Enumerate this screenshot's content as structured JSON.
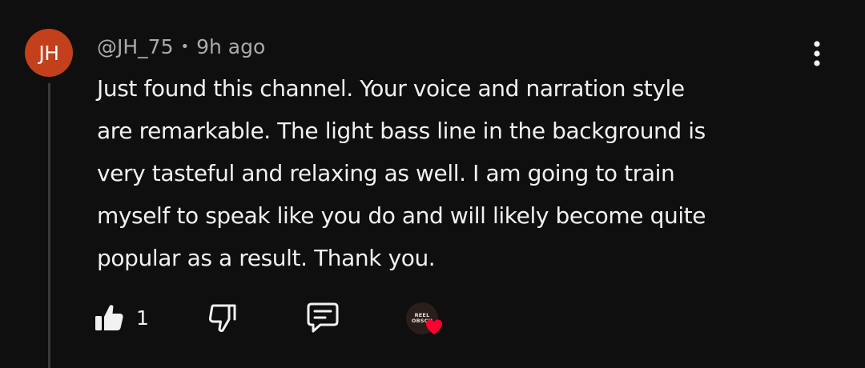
{
  "comment": {
    "avatar_initials": "JH",
    "avatar_color": "#c2401b",
    "author": "@JH_75",
    "separator": "•",
    "timestamp": "9h ago",
    "text": "Just found this channel.  Your voice and narration style\nare remarkable.  The light bass line in the background is\nvery tasteful and relaxing as well.  I am going to train\nmyself to speak like you do and will likely become quite\npopular as a result.  Thank you."
  },
  "actions": {
    "like_icon": "thumbs-up-filled-icon",
    "like_count": "1",
    "dislike_icon": "thumbs-down-outline-icon",
    "reply_icon": "comment-reply-icon",
    "creator_heart": {
      "avatar_line1": "REEL",
      "avatar_line2": "OBSCU",
      "heart_icon": "heart-icon",
      "heart_color": "#ff0033"
    }
  },
  "menu": {
    "icon": "more-vertical-icon"
  },
  "colors": {
    "background": "#0f0f0f",
    "primary_text": "#f1f1f1",
    "secondary_text": "#aaaaaa",
    "thread_line": "#3a3a3a"
  }
}
